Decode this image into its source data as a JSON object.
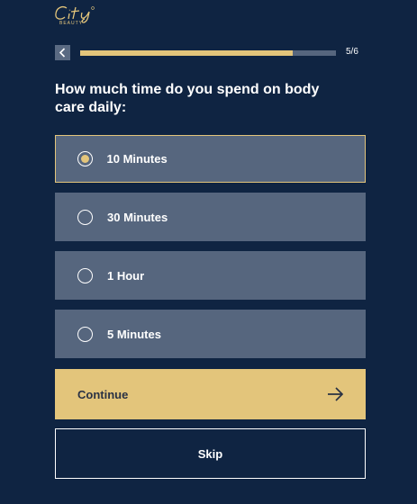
{
  "brand": {
    "logo_text": "City",
    "logo_sub": "BEAUTY",
    "accent_color": "#e3c57b",
    "background_color": "#0f2442",
    "option_color": "#56667e"
  },
  "header": {
    "back_icon": "chevron-left-icon",
    "progress": {
      "current": 5,
      "total": 6,
      "fill_fraction": 0.83,
      "label": "5/6"
    }
  },
  "question": {
    "text": "How much time do you spend on body care daily:"
  },
  "options": [
    {
      "label": "10 Minutes",
      "selected": true
    },
    {
      "label": "30 Minutes",
      "selected": false
    },
    {
      "label": "1 Hour",
      "selected": false
    },
    {
      "label": "5 Minutes",
      "selected": false
    }
  ],
  "actions": {
    "continue_label": "Continue",
    "continue_icon": "arrow-right-icon",
    "skip_label": "Skip"
  }
}
